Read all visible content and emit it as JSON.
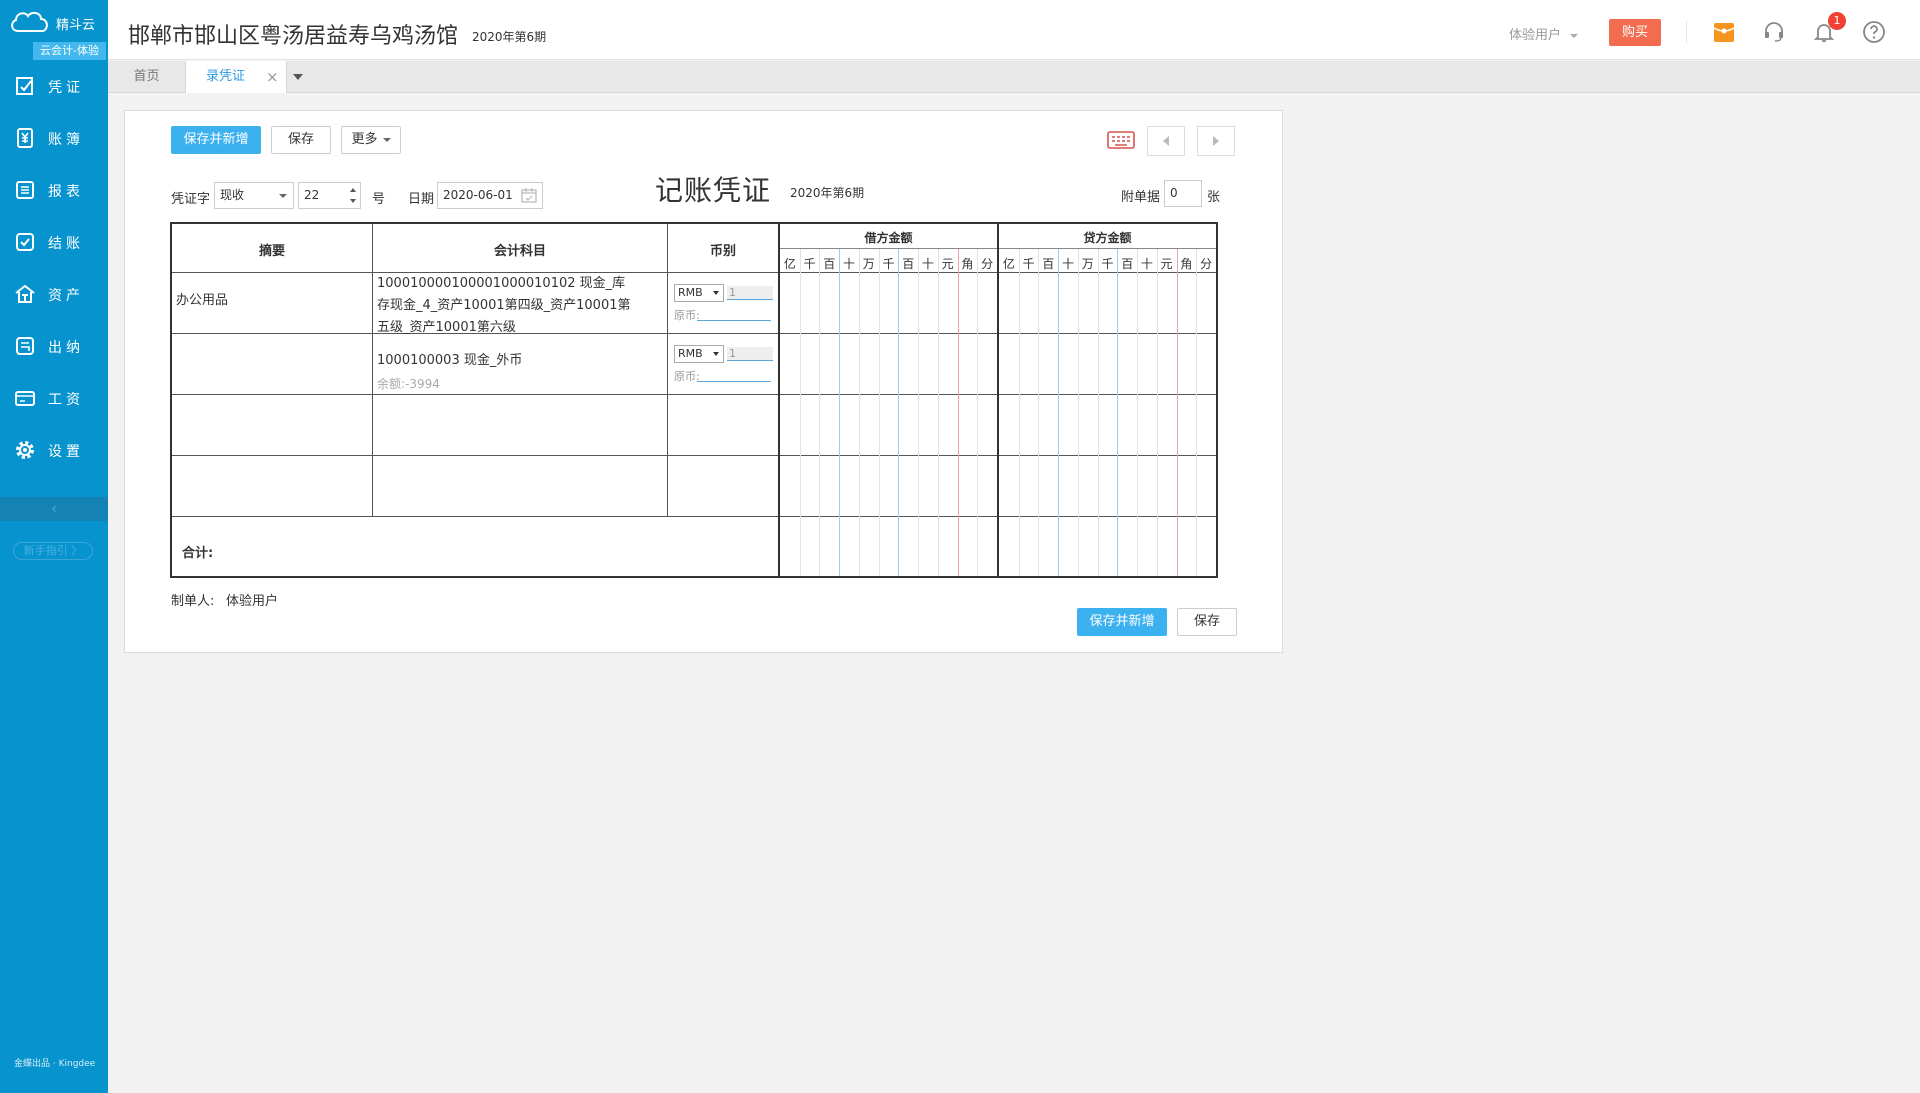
{
  "sidebar": {
    "logo_text": "精斗云",
    "edition": "云会计-体验",
    "items": [
      {
        "label": "凭证",
        "icon": "voucher-icon"
      },
      {
        "label": "账簿",
        "icon": "ledger-icon"
      },
      {
        "label": "报表",
        "icon": "report-icon"
      },
      {
        "label": "结账",
        "icon": "close-books-icon"
      },
      {
        "label": "资产",
        "icon": "asset-icon"
      },
      {
        "label": "出纳",
        "icon": "cashier-icon"
      },
      {
        "label": "工资",
        "icon": "salary-icon"
      },
      {
        "label": "设置",
        "icon": "gear-icon"
      }
    ],
    "collapse_glyph": "‹",
    "guide_label": "新手指引 〉",
    "footer": "金蝶出品 · Kingdee"
  },
  "header": {
    "company": "邯郸市邯山区粤汤居益寿乌鸡汤馆",
    "period": "2020年第6期",
    "user": "体验用户",
    "buy_label": "购买",
    "notification_count": "1"
  },
  "tabs": [
    {
      "label": "首页"
    },
    {
      "label": "录凭证",
      "close": "×"
    }
  ],
  "toolbar": {
    "save_new_label": "保存并新增",
    "save_label": "保存",
    "more_label": "更多"
  },
  "voucher": {
    "word_label": "凭证字",
    "word_value": "现收",
    "number_value": "22",
    "number_suffix": "号",
    "date_label": "日期",
    "date_value": "2020-06-01",
    "title": "记账凭证",
    "period": "2020年第6期",
    "attach_label": "附单据",
    "attach_value": "0",
    "attach_suffix": "张"
  },
  "grid": {
    "headers": {
      "summary": "摘要",
      "account": "会计科目",
      "currency": "币别",
      "debit": "借方金额",
      "credit": "贷方金额"
    },
    "digits": [
      "亿",
      "千",
      "百",
      "十",
      "万",
      "千",
      "百",
      "十",
      "元",
      "角",
      "分"
    ],
    "rows": [
      {
        "summary": "办公用品",
        "account": "100010000100001000010102 现金_库存现金_4_资产10001第四级_资产10001第五级_资产10001第六级",
        "balance": "",
        "currency": "RMB",
        "rate": "1",
        "orig_label": "原币:"
      },
      {
        "summary": "",
        "account": "1000100003 现金_外币",
        "balance": "余额:-3994",
        "currency": "RMB",
        "rate": "1",
        "orig_label": "原币:"
      }
    ],
    "total_label": "合计:"
  },
  "footer": {
    "creator_label": "制单人:",
    "creator_value": "体验用户",
    "save_new_label": "保存并新增",
    "save_label": "保存"
  },
  "colors": {
    "sidebar": "#0793ce",
    "primary": "#3cb1f0",
    "buy": "#f36c4f",
    "digit_blue": "#9ecbee",
    "digit_red": "#f3a3a3",
    "digit_normal": "#e2e2e2"
  }
}
